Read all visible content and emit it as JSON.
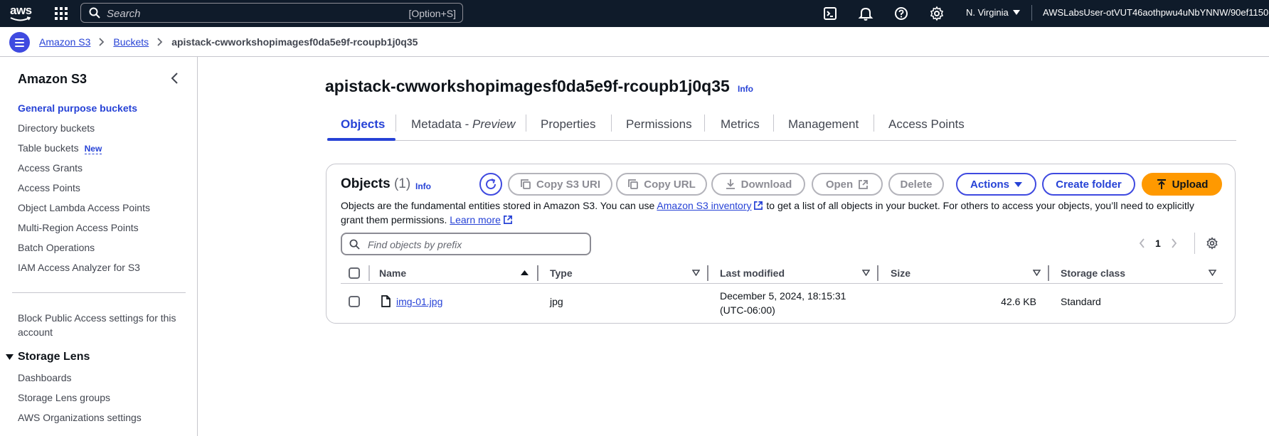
{
  "topnav": {
    "logo_text": "aws",
    "search_placeholder": "Search",
    "search_shortcut": "[Option+S]",
    "region": "N. Virginia",
    "account": "AWSLabsUser-otVUT46aothpwu4uNbYNNW/90ef1150-fa"
  },
  "breadcrumb": {
    "items": [
      "Amazon S3",
      "Buckets"
    ],
    "current": "apistack-cwworkshopimagesf0da5e9f-rcoupb1j0q35"
  },
  "sidebar": {
    "title": "Amazon S3",
    "items": [
      {
        "label": "General purpose buckets"
      },
      {
        "label": "Directory buckets"
      },
      {
        "label": "Table buckets",
        "badge": "New"
      },
      {
        "label": "Access Grants"
      },
      {
        "label": "Access Points"
      },
      {
        "label": "Object Lambda Access Points"
      },
      {
        "label": "Multi-Region Access Points"
      },
      {
        "label": "Batch Operations"
      },
      {
        "label": "IAM Access Analyzer for S3"
      }
    ],
    "block_public_access_line1": "Block Public Access settings for this",
    "block_public_access_line2": "account",
    "storage_lens": {
      "title": "Storage Lens",
      "items": [
        "Dashboards",
        "Storage Lens groups",
        "AWS Organizations settings"
      ]
    }
  },
  "main": {
    "title": "apistack-cwworkshopimagesf0da5e9f-rcoupb1j0q35",
    "info": "Info",
    "tabs": [
      {
        "label": "Objects"
      },
      {
        "label": "Metadata - "
      },
      {
        "label": "Properties"
      },
      {
        "label": "Permissions"
      },
      {
        "label": "Metrics"
      },
      {
        "label": "Management"
      },
      {
        "label": "Access Points"
      }
    ],
    "metadata_preview": "Preview"
  },
  "objects": {
    "heading": "Objects",
    "count": "(1)",
    "info": "Info",
    "buttons": {
      "copy_s3_uri": "Copy S3 URI",
      "copy_url": "Copy URL",
      "download": "Download",
      "open": "Open",
      "delete": "Delete",
      "actions": "Actions",
      "create_folder": "Create folder",
      "upload": "Upload"
    },
    "description_part1": "Objects are the fundamental entities stored in Amazon S3. You can use",
    "inventory_link": "Amazon S3 inventory",
    "description_part2": "to get a list of all objects in your bucket. For others to access your objects, you’ll need to explicitly",
    "description_line2": "grant them permissions.",
    "learn_more": "Learn more",
    "find_placeholder": "Find objects by prefix",
    "page_number": "1",
    "columns": [
      "Name",
      "Type",
      "Last modified",
      "Size",
      "Storage class"
    ],
    "rows": [
      {
        "name": "img-01.jpg",
        "type": "jpg",
        "last_modified_line1": "December 5, 2024, 18:15:31",
        "last_modified_line2": "(UTC-06:00)",
        "size": "42.6 KB",
        "storage_class": "Standard"
      }
    ]
  },
  "colors": {
    "nav_bg": "#0f1b2a",
    "link": "#2642d6",
    "primary": "#3f4ae0",
    "upload": "#ff9900"
  }
}
